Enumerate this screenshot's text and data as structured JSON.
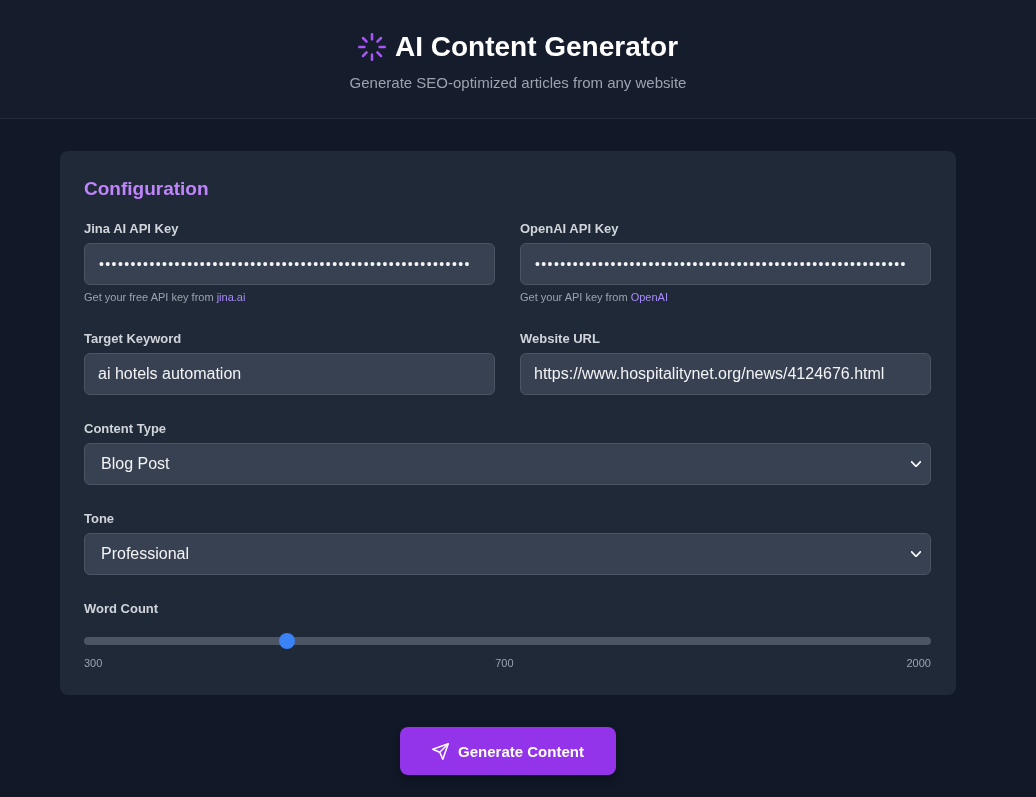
{
  "header": {
    "title": "AI Content Generator",
    "subtitle": "Generate SEO-optimized articles from any website"
  },
  "configuration": {
    "title": "Configuration",
    "fields": [
      {
        "kind": "password",
        "label": "Jina AI API Key",
        "value": "•••••••••••••••••••••••••••••••••••••••••••••••••••••••••••",
        "help": "Get your free API key from",
        "link": "jina.ai"
      },
      {
        "kind": "password",
        "label": "OpenAI API Key",
        "value": "•••••••••••••••••••••••••••••••••••••••••••••••••••••••••••",
        "help": "Get your API key from",
        "link": "OpenAI"
      },
      {
        "kind": "text",
        "label": "Target Keyword",
        "value": "ai hotels automation"
      },
      {
        "kind": "text",
        "label": "Website URL",
        "value": "https://www.hospitalitynet.org/news/4124676.html"
      },
      {
        "kind": "select",
        "label": "Content Type",
        "value": "Blog Post"
      },
      {
        "kind": "select",
        "label": "Tone",
        "value": "Professional"
      },
      {
        "kind": "slider",
        "label": "Word Count",
        "level": 0.24,
        "min_label": "300",
        "value_label": "700",
        "max_label": "2000"
      }
    ]
  },
  "generate_button": {
    "label": "Generate Content"
  }
}
